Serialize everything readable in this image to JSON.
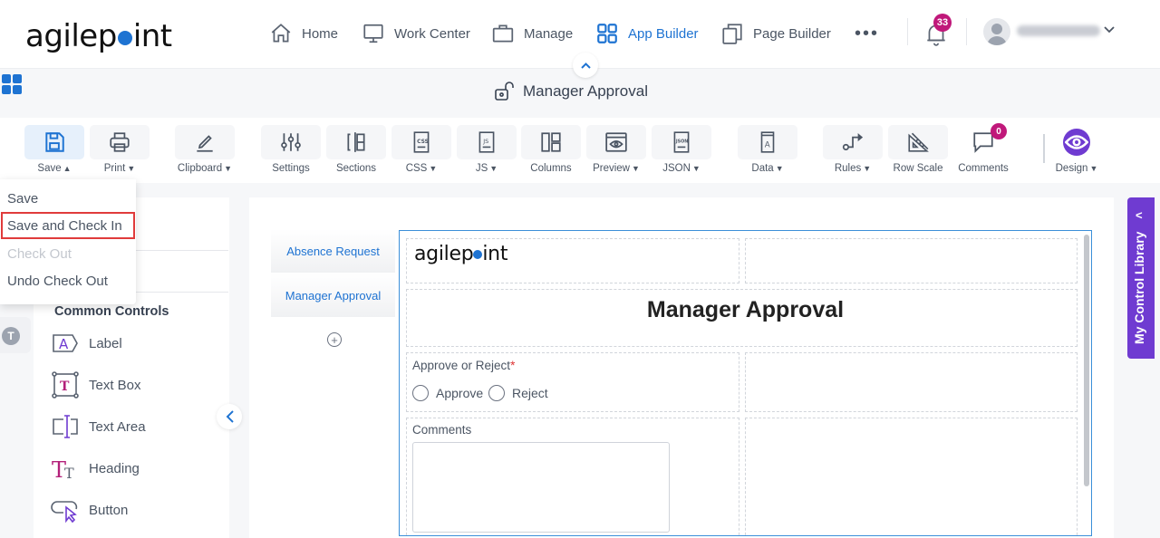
{
  "header": {
    "logo_text_a": "agilep",
    "logo_text_b": "int",
    "nav": [
      {
        "label": "Home",
        "icon": "home-icon"
      },
      {
        "label": "Work Center",
        "icon": "monitor-icon"
      },
      {
        "label": "Manage",
        "icon": "briefcase-icon"
      },
      {
        "label": "App Builder",
        "icon": "grid-icon",
        "active": true
      },
      {
        "label": "Page Builder",
        "icon": "copy-pages-icon"
      }
    ],
    "more": "•••",
    "notifications_count": "33",
    "user_chevron": "⌄",
    "collapse_icon": "^"
  },
  "title_bar": {
    "form_title": "Manager Approval",
    "lock_state": "unlocked"
  },
  "toolbar": {
    "items": [
      {
        "label": "Save",
        "chevron": "up",
        "icon": "save-icon",
        "active": true
      },
      {
        "label": "Print",
        "chevron": "down",
        "icon": "print-icon"
      },
      {
        "label": "Clipboard",
        "chevron": "down",
        "icon": "pencil-icon"
      },
      {
        "label": "Settings",
        "icon": "sliders-icon"
      },
      {
        "label": "Sections",
        "icon": "sections-icon"
      },
      {
        "label": "CSS",
        "chevron": "down",
        "icon": "css-file-icon"
      },
      {
        "label": "JS",
        "chevron": "down",
        "icon": "js-file-icon"
      },
      {
        "label": "Columns",
        "icon": "columns-icon"
      },
      {
        "label": "Preview",
        "chevron": "down",
        "icon": "preview-icon"
      },
      {
        "label": "JSON",
        "chevron": "down",
        "icon": "json-file-icon"
      },
      {
        "label": "Data",
        "chevron": "down",
        "icon": "data-book-icon"
      },
      {
        "label": "Rules",
        "chevron": "down",
        "icon": "rules-icon"
      },
      {
        "label": "Row Scale",
        "icon": "ruler-icon"
      },
      {
        "label": "Comments",
        "icon": "comment-icon",
        "badge": "0"
      },
      {
        "label": "Design",
        "chevron": "down",
        "icon": "eye-icon"
      }
    ],
    "chevron_down": "⌵",
    "chevron_up": "^"
  },
  "save_menu": {
    "items": [
      {
        "label": "Save",
        "enabled": true
      },
      {
        "label": "Save and Check In",
        "enabled": true,
        "highlighted": true
      },
      {
        "label": "Check Out",
        "enabled": false
      },
      {
        "label": "Undo Check Out",
        "enabled": true
      }
    ]
  },
  "left_panel": {
    "rail_badge": "T",
    "section_heading": "Common Controls",
    "controls": [
      {
        "label": "Label",
        "icon": "label-control-icon"
      },
      {
        "label": "Text Box",
        "icon": "textbox-control-icon"
      },
      {
        "label": "Text Area",
        "icon": "textarea-control-icon"
      },
      {
        "label": "Heading",
        "icon": "heading-control-icon"
      },
      {
        "label": "Button",
        "icon": "button-control-icon"
      }
    ]
  },
  "pages": {
    "tabs": [
      "Absence Request",
      "Manager Approval"
    ],
    "add_label": "+"
  },
  "form": {
    "logo_text_a": "agilep",
    "logo_text_b": "int",
    "heading": "Manager Approval",
    "approve_field": {
      "label": "Approve or Reject",
      "required_mark": "*",
      "options": [
        "Approve",
        "Reject"
      ]
    },
    "comments_field": {
      "label": "Comments",
      "value": ""
    }
  },
  "right_tab": {
    "label": "My Control Library",
    "chevron": "<"
  },
  "colors": {
    "accent_blue": "#1e73d2",
    "badge_magenta": "#c0187a",
    "design_purple": "#6f3bd1",
    "highlight_red": "#e03b3b"
  }
}
